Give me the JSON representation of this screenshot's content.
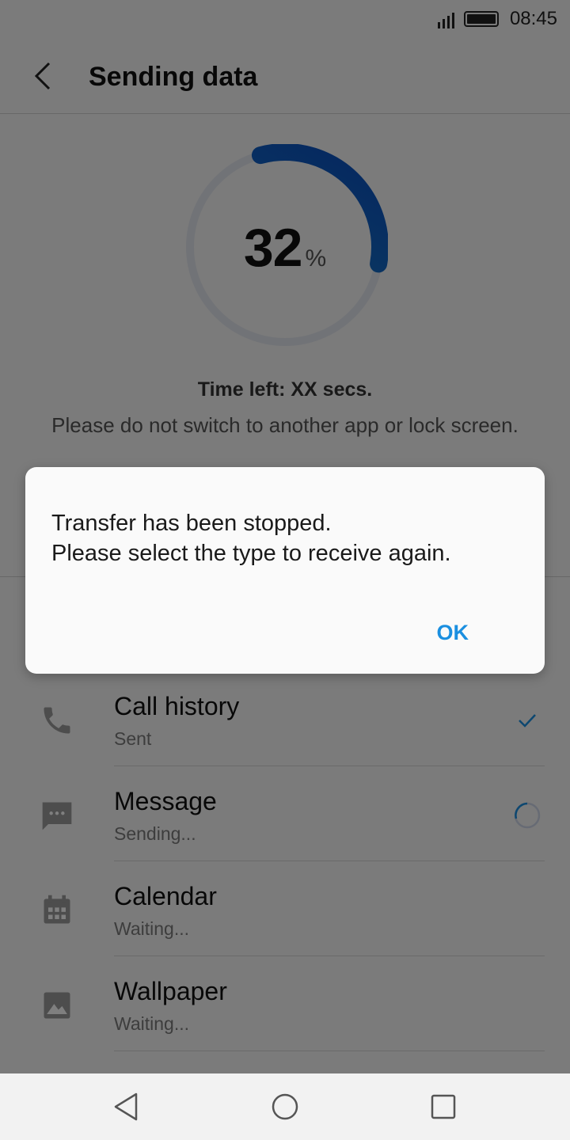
{
  "status_bar": {
    "time": "08:45"
  },
  "header": {
    "title": "Sending data"
  },
  "progress": {
    "percent": 32,
    "unit": "%",
    "value_text": "32"
  },
  "time_left": "Time left: XX secs.",
  "warning": "Please do not switch to another app or lock screen.",
  "items": [
    {
      "title": "Call history",
      "status": "Sent",
      "icon": "phone-icon",
      "state": "done"
    },
    {
      "title": "Message",
      "status": "Sending...",
      "icon": "message-icon",
      "state": "in-progress"
    },
    {
      "title": "Calendar",
      "status": "Waiting...",
      "icon": "calendar-icon",
      "state": "waiting"
    },
    {
      "title": "Wallpaper",
      "status": "Waiting...",
      "icon": "image-icon",
      "state": "waiting"
    }
  ],
  "dialog": {
    "line1": "Transfer has been stopped.",
    "line2": "Please select the type to receive again.",
    "ok_label": "OK"
  },
  "colors": {
    "accent": "#1a8fe0",
    "progress_start": "#1e90c8",
    "progress_end": "#0a4cc0"
  },
  "nav": {
    "back": "back-icon",
    "home": "home-icon",
    "recents": "recents-icon"
  }
}
